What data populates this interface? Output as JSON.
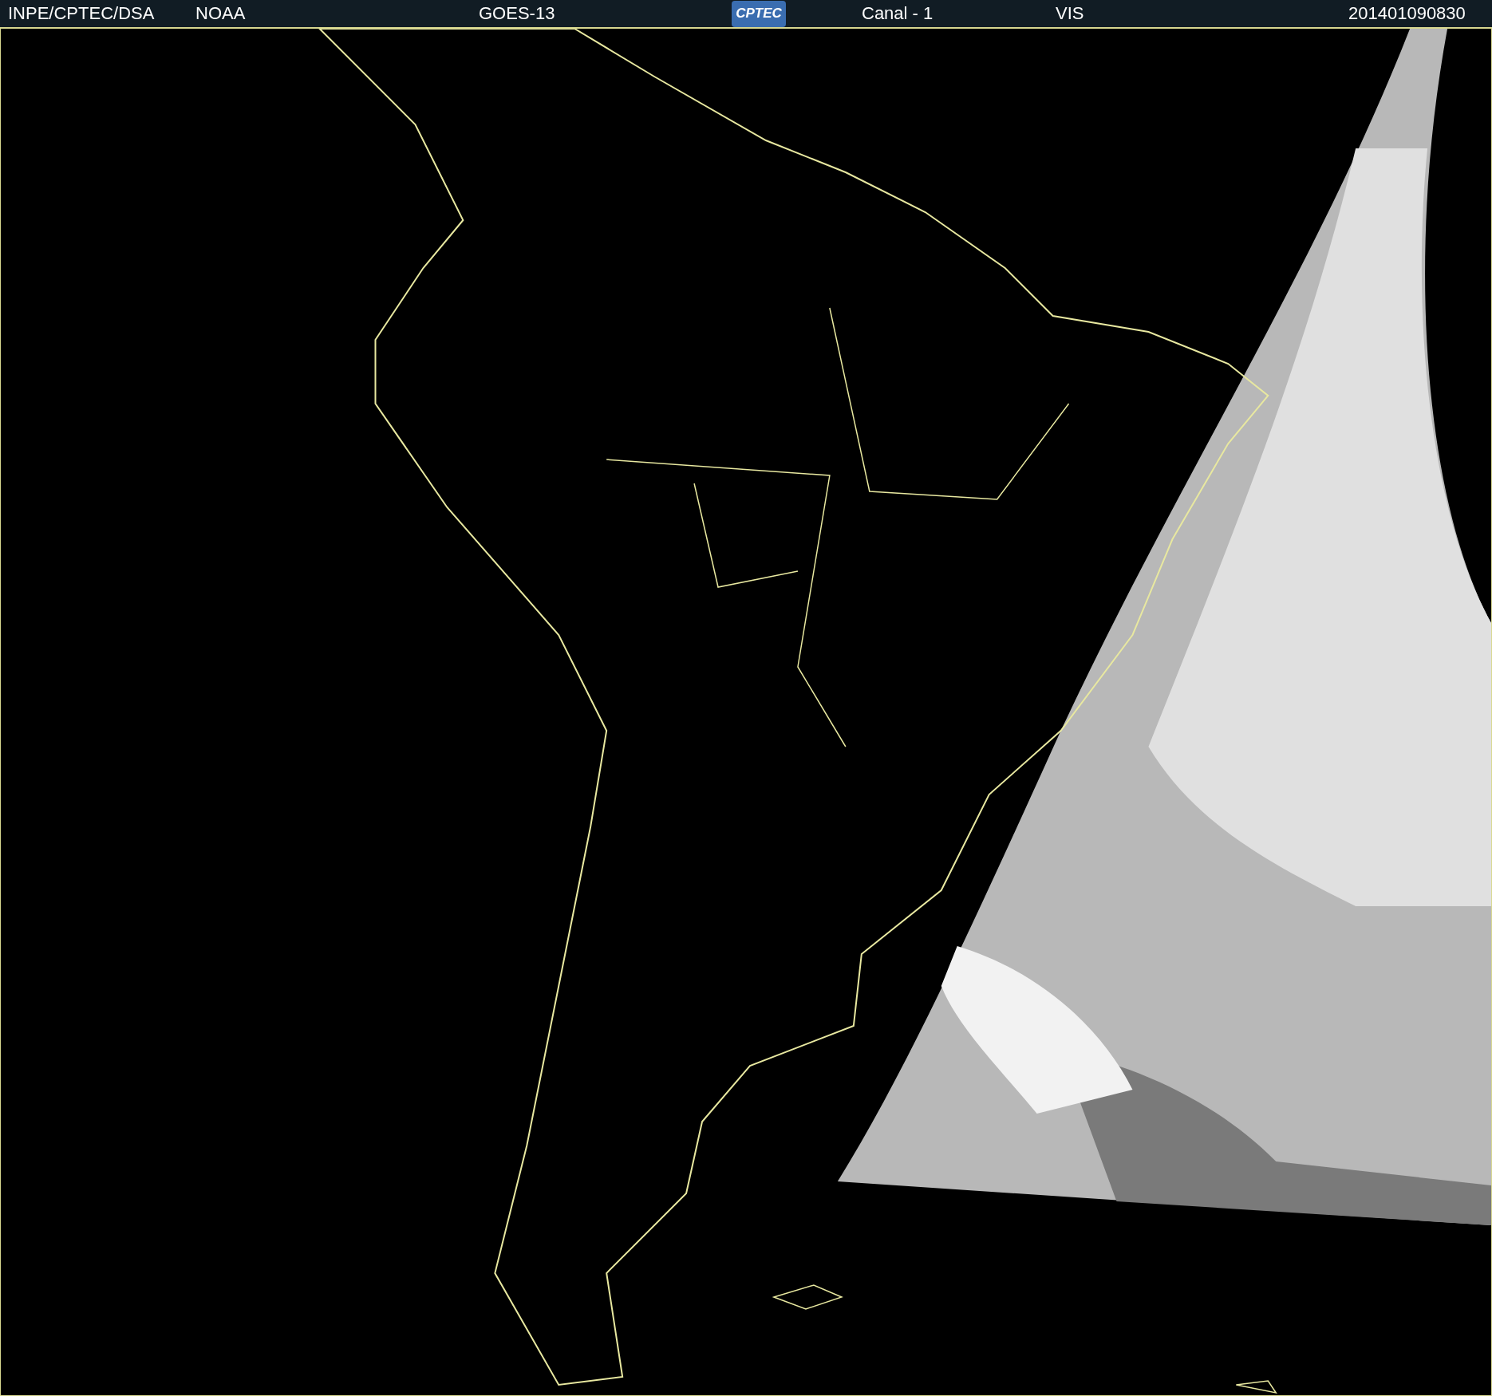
{
  "header": {
    "source": "INPE/CPTEC/DSA",
    "agency": "NOAA",
    "satellite": "GOES-13",
    "logo": "CPTEC",
    "channel": "Canal - 1",
    "band": "VIS",
    "timestamp": "201401090830"
  }
}
